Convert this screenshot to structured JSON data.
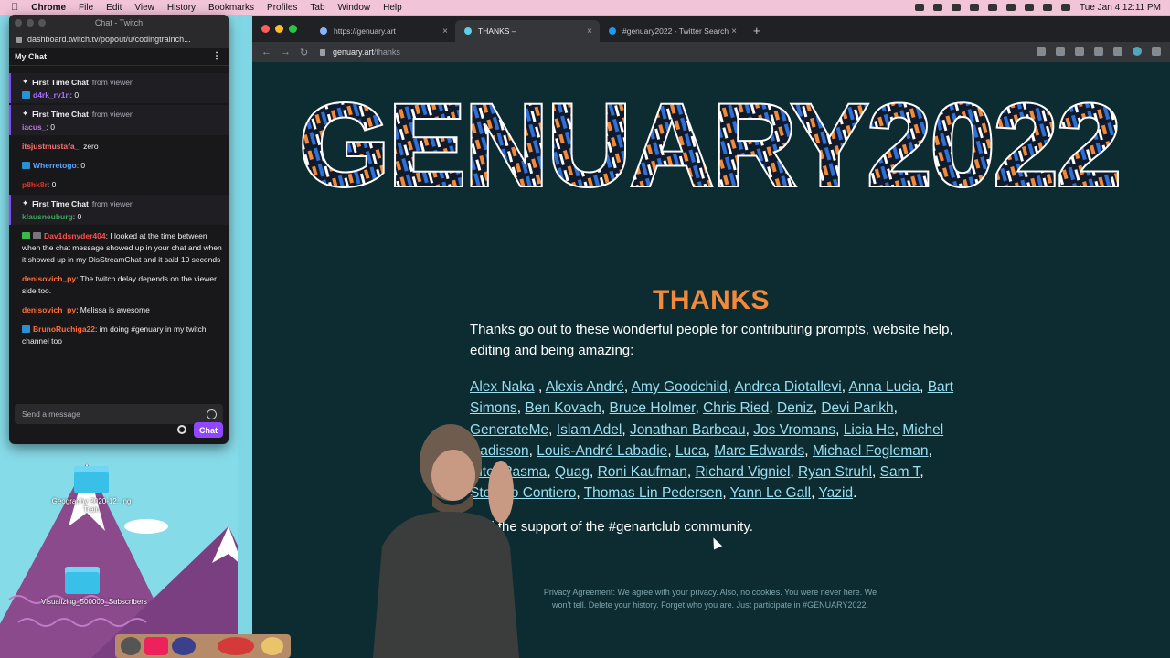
{
  "menubar": {
    "app": "Chrome",
    "items": [
      "File",
      "Edit",
      "View",
      "History",
      "Bookmarks",
      "Profiles",
      "Tab",
      "Window",
      "Help"
    ],
    "clock": "Tue Jan 4  12:11 PM"
  },
  "twitch": {
    "window_title": "Chat - Twitch",
    "url": "dashboard.twitch.tv/popout/u/codingtrainch...",
    "chat_title": "My Chat",
    "messages": [
      {
        "first_time": true,
        "label": "First Time Chat",
        "from": "from viewer",
        "user": "d4rk_rv1n",
        "text": ": 0",
        "color": "#a970ff"
      },
      {
        "first_time": true,
        "label": "First Time Chat",
        "from": "from viewer",
        "user": "iacus_",
        "text": ": 0",
        "color": "#b57ad6"
      },
      {
        "user": "itsjustmustafa_",
        "text": ": zero",
        "color": "#ff7070"
      },
      {
        "user": "Wherretogo",
        "text": ": 0",
        "color": "#5ca8ff"
      },
      {
        "user": "p8hk8r",
        "text": ": 0",
        "color": "#e0322f"
      },
      {
        "first_time": true,
        "label": "First Time Chat",
        "from": "from viewer",
        "user": "klausneuburg",
        "text": ": 0",
        "color": "#3aa65a"
      },
      {
        "user": "Dav1dsnyder404",
        "text": ": I looked at the time between when the chat message showed up in your chat and when it showed up in my DisStreamChat and it said 10 seconds",
        "color": "#ff4f4f"
      },
      {
        "user": "denisovich_py",
        "text": ": The twitch delay depends on the viewer side too.",
        "color": "#ff6e3a"
      },
      {
        "user": "denisovich_py",
        "text": ": Melissa is awesome",
        "color": "#ff6e3a"
      },
      {
        "user": "BrunoRuchiga22",
        "text": ": im doing #genuary in my twitch channel too",
        "color": "#ff6e3a"
      }
    ],
    "compose_placeholder": "Send a message",
    "chat_button": "Chat"
  },
  "desktop": {
    "icons": [
      {
        "label": "Geography 2020-12...ng Train"
      },
      {
        "label": "Visualizing_500000_Subscribers"
      }
    ]
  },
  "chrome": {
    "tabs": [
      {
        "title": "https://genuary.art",
        "active": false,
        "fav_color": "#8ab4f8"
      },
      {
        "title": "THANKS –",
        "active": true,
        "fav_color": "#5ad1e8"
      },
      {
        "title": "#genuary2022 - Twitter Search",
        "active": false,
        "fav_color": "#1d9bf0"
      }
    ],
    "url_host": "genuary.art",
    "url_path": "/thanks"
  },
  "page": {
    "logo_text": "GENUARY2022",
    "title": "THANKS",
    "intro": "Thanks go out to these wonderful people for contributing prompts, website help, editing and being amazing:",
    "names": [
      "Alex Naka",
      "Alexis André",
      "Amy Goodchild",
      "Andrea Diotallevi",
      "Anna Lucia",
      "Bart Simons",
      "Ben Kovach",
      "Bruce Holmer",
      "Chris Ried",
      "Deniz",
      "Devi Parikh",
      "GenerateMe",
      "Islam Adel",
      "Jonathan Barbeau",
      "Jos Vromans",
      "Licia He",
      "Michel Radisson",
      "Louis-André Labadie",
      "Luca",
      "Marc Edwards",
      "Michael Fogleman",
      "Piter Pasma",
      "Quag",
      "Roni Kaufman",
      "Richard Vigniel",
      "Ryan Struhl",
      "Sam T",
      "Stefano Contiero",
      "Thomas Lin Pedersen",
      "Yann Le Gall",
      "Yazid"
    ],
    "community": "And the support of the #genartclub community.",
    "privacy": "Privacy Agreement: We agree with your privacy. Also, no cookies. You were never here. We won't tell. Delete your history. Forget who you are. Just participate in #GENUARY2022."
  }
}
